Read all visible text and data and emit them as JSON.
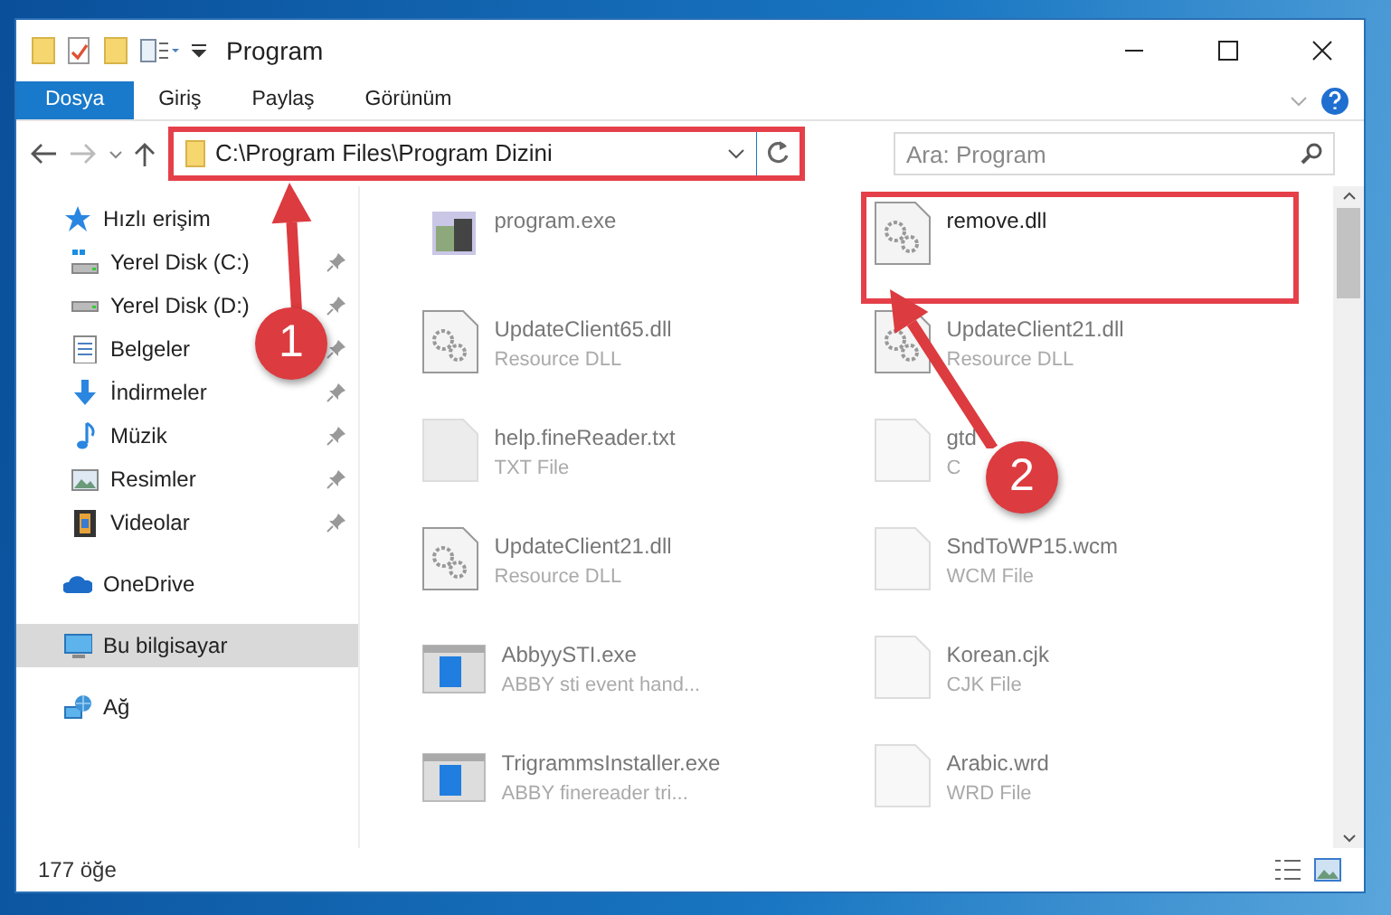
{
  "window": {
    "title": "Program"
  },
  "ribbon": {
    "tabs": [
      {
        "label": "Dosya",
        "selected": true
      },
      {
        "label": "Giriş",
        "selected": false
      },
      {
        "label": "Paylaş",
        "selected": false
      },
      {
        "label": "Görünüm",
        "selected": false
      }
    ]
  },
  "address": {
    "path": "C:\\Program Files\\Program Dizini",
    "highlighted": true
  },
  "search": {
    "placeholder": "Ara: Program"
  },
  "sidebar": {
    "items": [
      {
        "label": "Hızlı erişim",
        "kind": "star",
        "selected": false,
        "children": [
          {
            "label": "Yerel Disk (C:)",
            "kind": "systemdrive",
            "pinned": true,
            "selected": false
          },
          {
            "label": "Yerel Disk (D:)",
            "kind": "drive",
            "pinned": true,
            "selected": false
          },
          {
            "label": "Belgeler",
            "kind": "document",
            "pinned": true,
            "selected": false
          },
          {
            "label": "İndirmeler",
            "kind": "download",
            "pinned": true,
            "selected": false
          },
          {
            "label": "Müzik",
            "kind": "music",
            "pinned": true,
            "selected": false
          },
          {
            "label": "Resimler",
            "kind": "pictures",
            "pinned": true,
            "selected": false
          },
          {
            "label": "Videolar",
            "kind": "video",
            "pinned": true,
            "selected": false
          }
        ]
      },
      {
        "label": "OneDrive",
        "kind": "cloud",
        "selected": false
      },
      {
        "label": "Bu bilgisayar",
        "kind": "computer",
        "selected": true
      },
      {
        "label": "Ağ",
        "kind": "network",
        "selected": false
      }
    ]
  },
  "files": [
    {
      "name": "program.exe",
      "kind": "installer",
      "highlighted": false
    },
    {
      "name": "remove.dll",
      "kind": "dll",
      "highlighted": true
    },
    {
      "name": "UpdateClient65.dll",
      "type": "Resource DLL",
      "kind": "dll",
      "highlighted": false
    },
    {
      "name": "UpdateClient21.dll",
      "type": "Resource DLL",
      "kind": "dll",
      "highlighted": false
    },
    {
      "name": "help.fineReader.txt",
      "type": "TXT File",
      "kind": "text",
      "highlighted": false
    },
    {
      "name": "gtd",
      "type": "C",
      "kind": "blank",
      "highlighted": false
    },
    {
      "name": "UpdateClient21.dll",
      "type": "Resource DLL",
      "kind": "dll",
      "highlighted": false
    },
    {
      "name": "SndToWP15.wcm",
      "type": "WCM File",
      "kind": "blank",
      "highlighted": false
    },
    {
      "name": "AbbyySTI.exe",
      "type": "ABBY sti event hand...",
      "kind": "app",
      "highlighted": false
    },
    {
      "name": "Korean.cjk",
      "type": "CJK File",
      "kind": "blank",
      "highlighted": false
    },
    {
      "name": "TrigrammsInstaller.exe",
      "type": "ABBY finereader tri...",
      "kind": "app",
      "highlighted": false
    },
    {
      "name": "Arabic.wrd",
      "type": "WRD File",
      "kind": "blank",
      "highlighted": false
    }
  ],
  "callouts": [
    {
      "label": "1"
    },
    {
      "label": "2"
    }
  ],
  "status_bar": {
    "count": "177 öğe"
  }
}
